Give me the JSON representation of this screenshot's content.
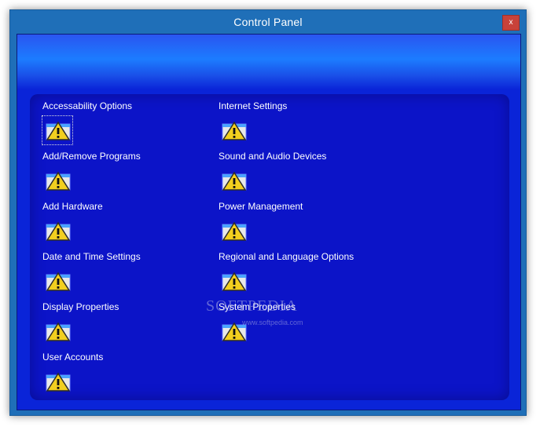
{
  "window": {
    "title": "Control Panel",
    "close_label": "x"
  },
  "items": [
    {
      "label": "Accessability Options"
    },
    {
      "label": "Add/Remove Programs"
    },
    {
      "label": "Add Hardware"
    },
    {
      "label": "Date and Time Settings"
    },
    {
      "label": "Display Properties"
    },
    {
      "label": "User Accounts"
    },
    {
      "label": "Internet Settings"
    },
    {
      "label": "Sound and Audio Devices"
    },
    {
      "label": "Power Management"
    },
    {
      "label": "Regional and Language Options"
    },
    {
      "label": "System Properties"
    }
  ],
  "watermark": {
    "text": "SOFTPEDIA",
    "url": "www.softpedia.com"
  },
  "colors": {
    "accent": "#1f6fb8",
    "client": "#0a24d8",
    "icon_warning": "#f2cf1f"
  },
  "icon": "warning-icon"
}
